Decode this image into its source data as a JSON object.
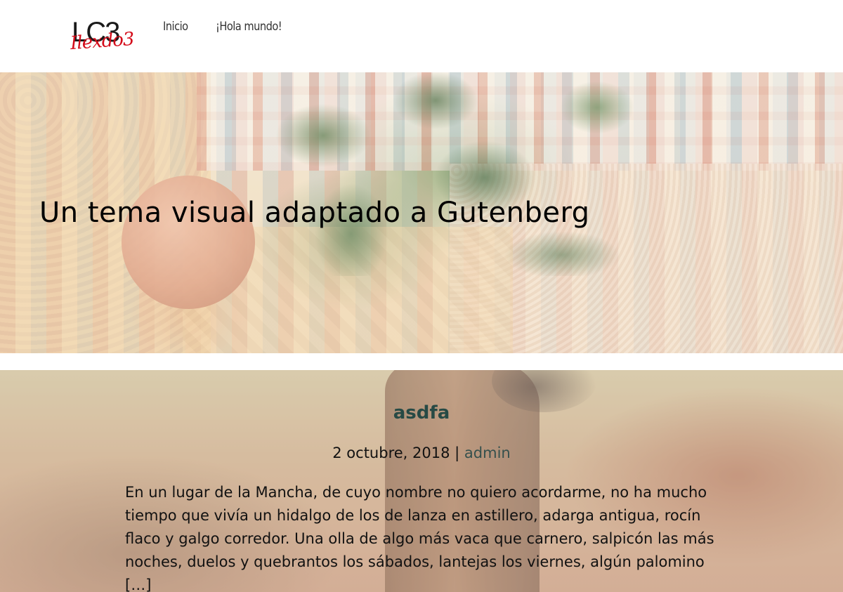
{
  "header": {
    "logo": {
      "letters": "LC3",
      "script": "Ilexdo3"
    },
    "nav": [
      {
        "label": "Inicio"
      },
      {
        "label": "¡Hola mundo!"
      }
    ]
  },
  "hero": {
    "title": "Un tema visual adaptado a Gutenberg"
  },
  "post": {
    "title": "asdfa",
    "date": "2 octubre, 2018",
    "separator": "|",
    "author": "admin",
    "excerpt": "En un lugar de la Mancha, de cuyo nombre no quiero acordarme, no ha mucho tiempo que vivía un hidalgo de los de lanza en astillero, adarga antigua, rocín flaco y galgo corredor. Una olla de algo más vaca que carnero, salpicón las más noches, duelos y quebrantos los sábados, lantejas los viernes, algún palomino […]"
  },
  "colors": {
    "logo_red": "#d40c1a",
    "post_title": "#274a45",
    "author_link": "#35504d"
  }
}
